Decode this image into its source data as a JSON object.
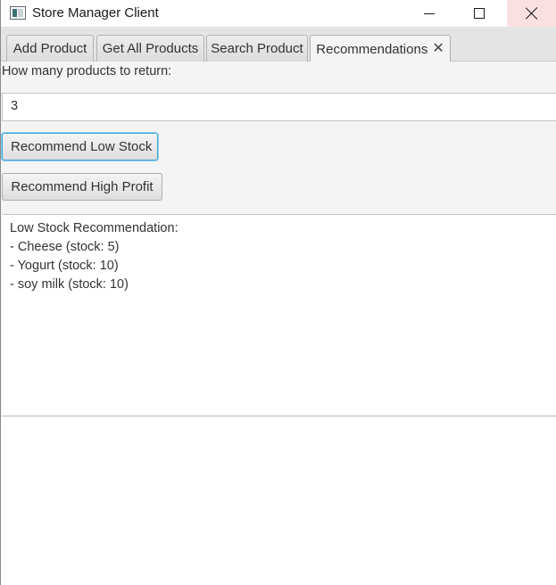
{
  "window": {
    "title": "Store Manager Client",
    "icon": "app-window-icon",
    "controls": [
      "minimize-icon",
      "maximize-icon",
      "close-icon"
    ]
  },
  "tabs": [
    {
      "label": "Add Product",
      "active": false
    },
    {
      "label": "Get All Products",
      "active": false
    },
    {
      "label": "Search Product",
      "active": false
    },
    {
      "label": "Recommendations",
      "active": true,
      "closable": true,
      "close_glyph": "✕"
    }
  ],
  "recommendations": {
    "prompt": "How many products to return:",
    "count_value": "3",
    "low_stock_button": "Recommend Low Stock",
    "high_profit_button": "Recommend High Profit",
    "result_lines": [
      "Low Stock Recommendation:",
      "- Cheese (stock: 5)",
      "- Yogurt (stock: 10)",
      "- soy milk (stock: 10)"
    ]
  },
  "colors": {
    "focus_accent": "#3aa6d6",
    "close_hover": "#fbe0e3"
  }
}
